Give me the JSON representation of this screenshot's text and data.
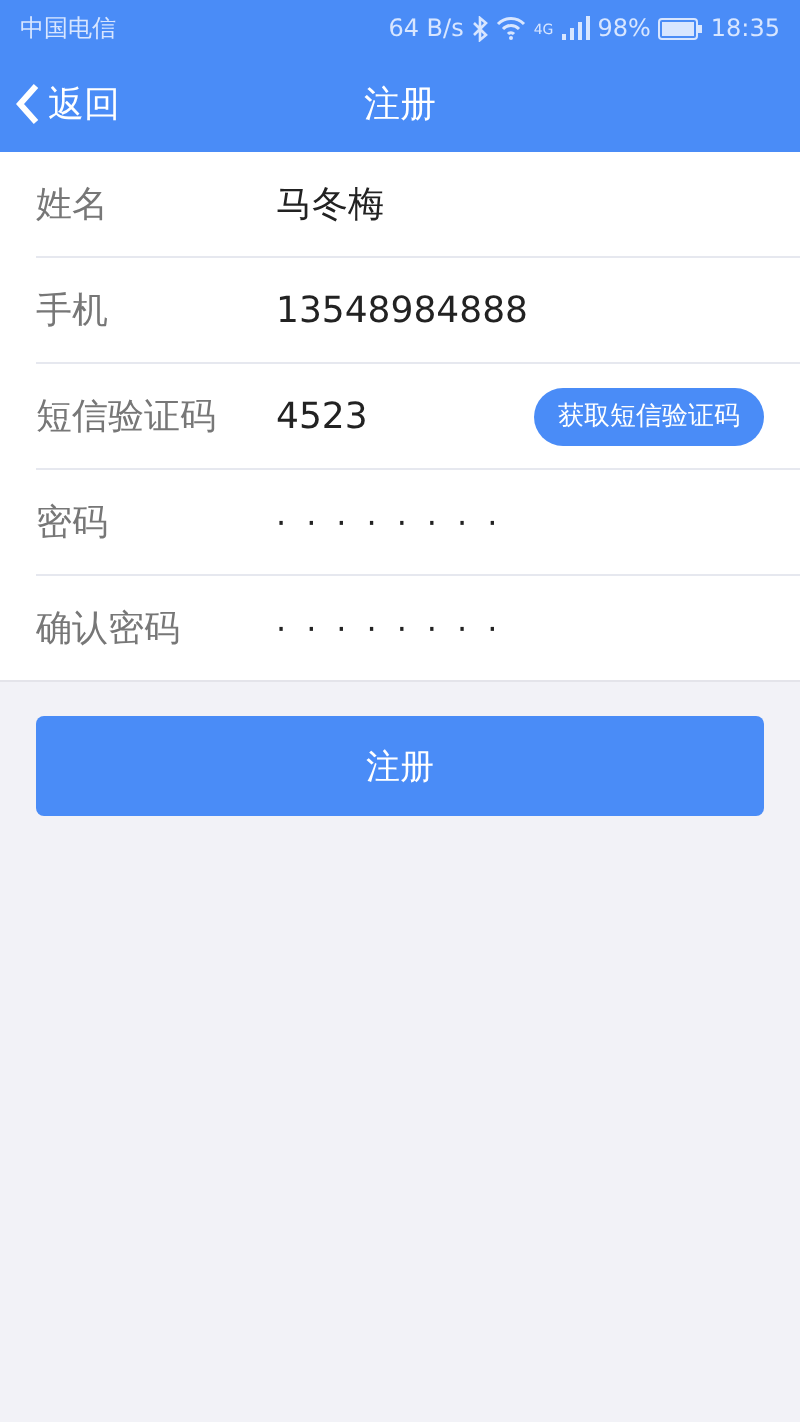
{
  "status_bar": {
    "carrier": "中国电信",
    "speed": "64 B/s",
    "network": "4G",
    "battery": "98%",
    "time": "18:35"
  },
  "nav": {
    "back": "返回",
    "title": "注册"
  },
  "fields": [
    {
      "kind": "text",
      "label": "姓名",
      "value": "马冬梅"
    },
    {
      "kind": "text",
      "label": "手机",
      "value": "13548984888"
    },
    {
      "kind": "code",
      "label": "短信验证码",
      "value": "4523",
      "button": "获取短信验证码"
    },
    {
      "kind": "password",
      "label": "密码",
      "value": "········"
    },
    {
      "kind": "password",
      "label": "确认密码",
      "value": "········"
    }
  ],
  "submit": "注册"
}
